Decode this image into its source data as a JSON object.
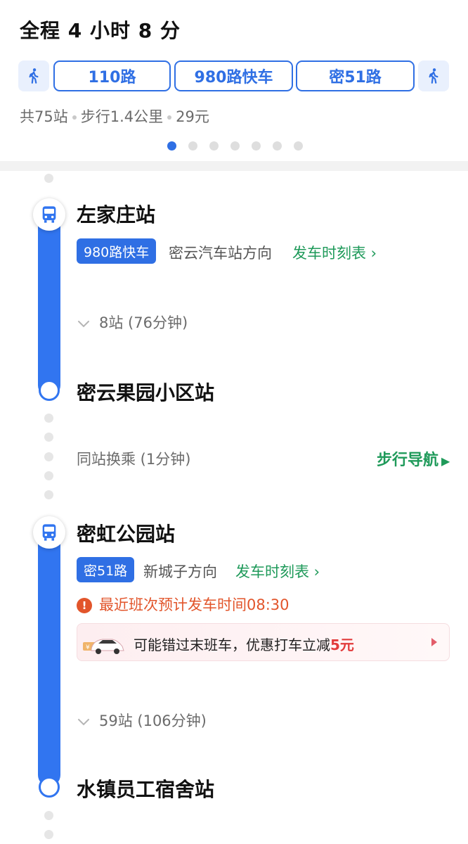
{
  "header": {
    "title": "全程 4 小时 8 分",
    "segments": [
      "110路",
      "980路快车",
      "密51路"
    ],
    "summary": {
      "stops": "共75站",
      "walk": "步行1.4公里",
      "price": "29元"
    },
    "pager": {
      "total": 7,
      "active": 0
    }
  },
  "leg1": {
    "board_station": "左家庄站",
    "route": "980路快车",
    "direction": "密云汽车站方向",
    "timetable": "发车时刻表 ›",
    "stops": "8站 (76分钟)",
    "alight_station": "密云果园小区站"
  },
  "transfer": {
    "text": "同站换乘 (1分钟)",
    "nav": "步行导航"
  },
  "leg2": {
    "board_station": "密虹公园站",
    "route": "密51路",
    "direction": "新城子方向",
    "timetable": "发车时刻表 ›",
    "alert": "最近班次预计发车时间08:30",
    "alert_icon": "!",
    "taxi": {
      "text": "可能错过末班车，优惠打车立减",
      "amount": "5元"
    },
    "stops": "59站 (106分钟)",
    "alight_station": "水镇员工宿舍站"
  },
  "colors": {
    "accent": "#2f6fe4",
    "bar": "#3175f0",
    "green": "#1f9a5a",
    "alert": "#e2552b"
  }
}
